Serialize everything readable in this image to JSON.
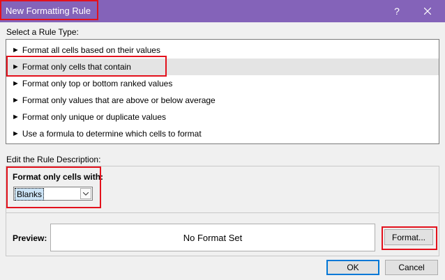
{
  "window": {
    "title": "New Formatting Rule",
    "help_glyph": "?",
    "close_glyph": "✕"
  },
  "rule_types": {
    "label": "Select a Rule Type:",
    "selected_index": 1,
    "items": [
      {
        "label": "Format all cells based on their values"
      },
      {
        "label": "Format only cells that contain"
      },
      {
        "label": "Format only top or bottom ranked values"
      },
      {
        "label": "Format only values that are above or below average"
      },
      {
        "label": "Format only unique or duplicate values"
      },
      {
        "label": "Use a formula to determine which cells to format"
      }
    ]
  },
  "description": {
    "label": "Edit the Rule Description:",
    "format_cells_label": "Format only cells with:",
    "condition_value": "Blanks",
    "preview_label": "Preview:",
    "preview_text": "No Format Set",
    "format_button": "Format..."
  },
  "buttons": {
    "ok": "OK",
    "cancel": "Cancel"
  },
  "colors": {
    "titlebar": "#8463b9",
    "highlight_box": "#e3111c"
  },
  "icons": {
    "list_arrow": "arrow-right-icon",
    "dropdown": "chevron-down-icon"
  }
}
